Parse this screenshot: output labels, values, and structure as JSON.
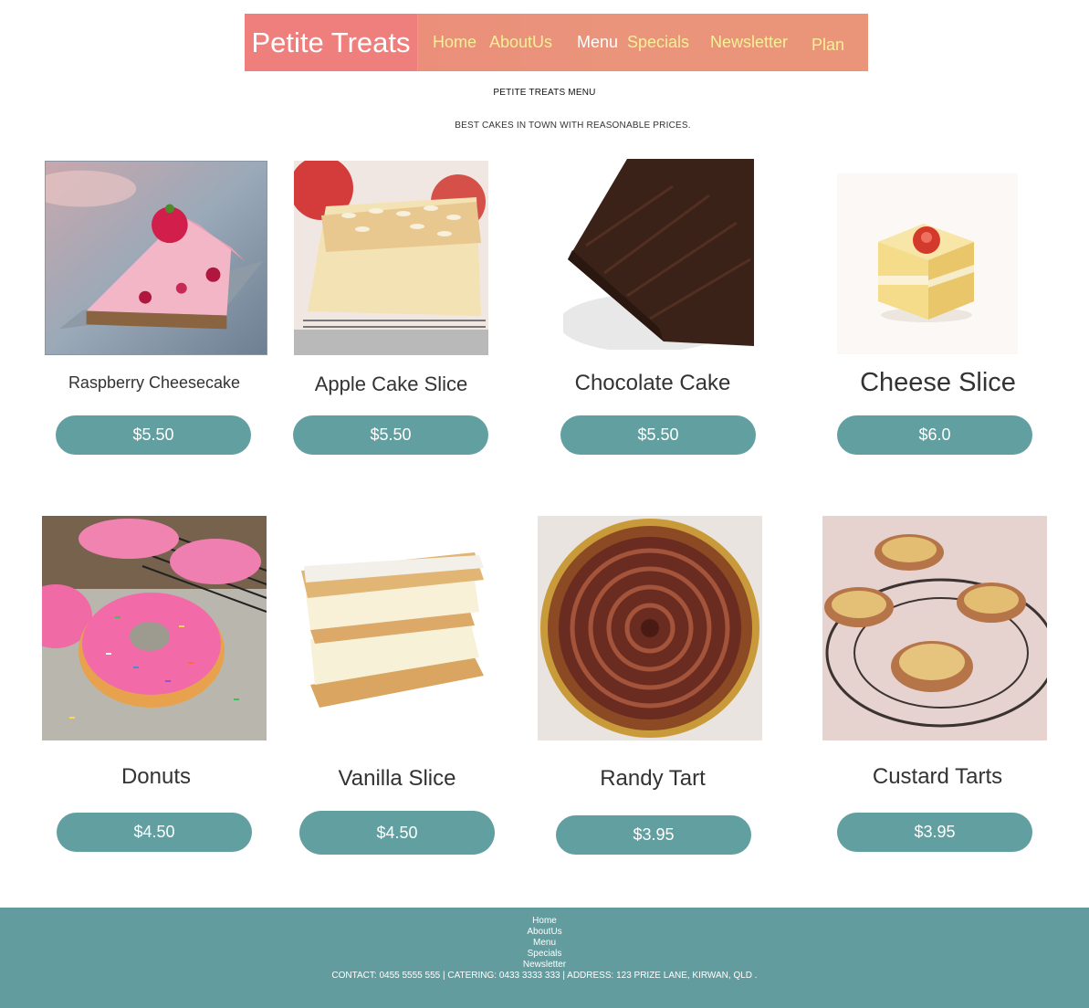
{
  "header": {
    "brand": "Petite Treats",
    "nav": [
      {
        "label": "Home"
      },
      {
        "label": "AboutUs"
      },
      {
        "label": "Menu"
      },
      {
        "label": "Specials"
      },
      {
        "label": "Newsletter"
      },
      {
        "label": "Plan"
      }
    ],
    "accent_color": "#f5f096",
    "active_item": "Menu"
  },
  "page": {
    "title": "PETITE TREATS MENU",
    "subtitle": "BEST CAKES IN TOWN WITH REASONABLE PRICES."
  },
  "products": [
    {
      "name": "Raspberry Cheesecake",
      "price": "$5.50",
      "image": "raspberry-cheesecake-image"
    },
    {
      "name": "Apple Cake Slice",
      "price": "$5.50",
      "image": "apple-cake-slice-image"
    },
    {
      "name": "Chocolate Cake",
      "price": "$5.50",
      "image": "chocolate-cake-image"
    },
    {
      "name": "Cheese Slice",
      "price": "$6.0",
      "image": "cheese-slice-image"
    },
    {
      "name": "Donuts",
      "price": "$4.50",
      "image": "donuts-image"
    },
    {
      "name": "Vanilla Slice",
      "price": "$4.50",
      "image": "vanilla-slice-image"
    },
    {
      "name": "Randy Tart",
      "price": "$3.95",
      "image": "randy-tart-image"
    },
    {
      "name": "Custard Tarts",
      "price": "$3.95",
      "image": "custard-tarts-image"
    }
  ],
  "button_color": "#629fa0",
  "footer": {
    "links": [
      "Home",
      "AboutUs",
      "Menu",
      "Specials",
      "Newsletter"
    ],
    "contact": "CONTACT: 0455 5555 555 | CATERING: 0433 3333 333 | ADDRESS: 123 PRIZE LANE, KIRWAN, QLD ."
  }
}
